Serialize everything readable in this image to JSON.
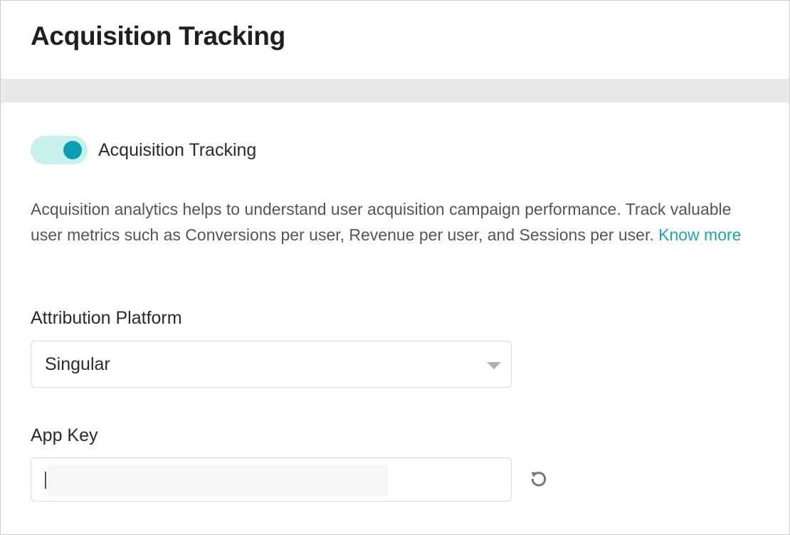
{
  "page": {
    "title": "Acquisition Tracking"
  },
  "toggle": {
    "label": "Acquisition Tracking",
    "enabled": true,
    "track_color": "#c7f1ea",
    "knob_color": "#0a9fb1"
  },
  "description": {
    "text": "Acquisition analytics helps to understand user acquisition campaign performance. Track valuable user metrics such as Conversions per user, Revenue per user, and Sessions per user. ",
    "link_label": "Know more",
    "link_color": "#17a7b3"
  },
  "attribution_platform": {
    "label": "Attribution Platform",
    "selected": "Singular",
    "icon": "chevron-down-icon"
  },
  "app_key": {
    "label": "App Key",
    "value": "",
    "reset_icon": "refresh-icon"
  }
}
